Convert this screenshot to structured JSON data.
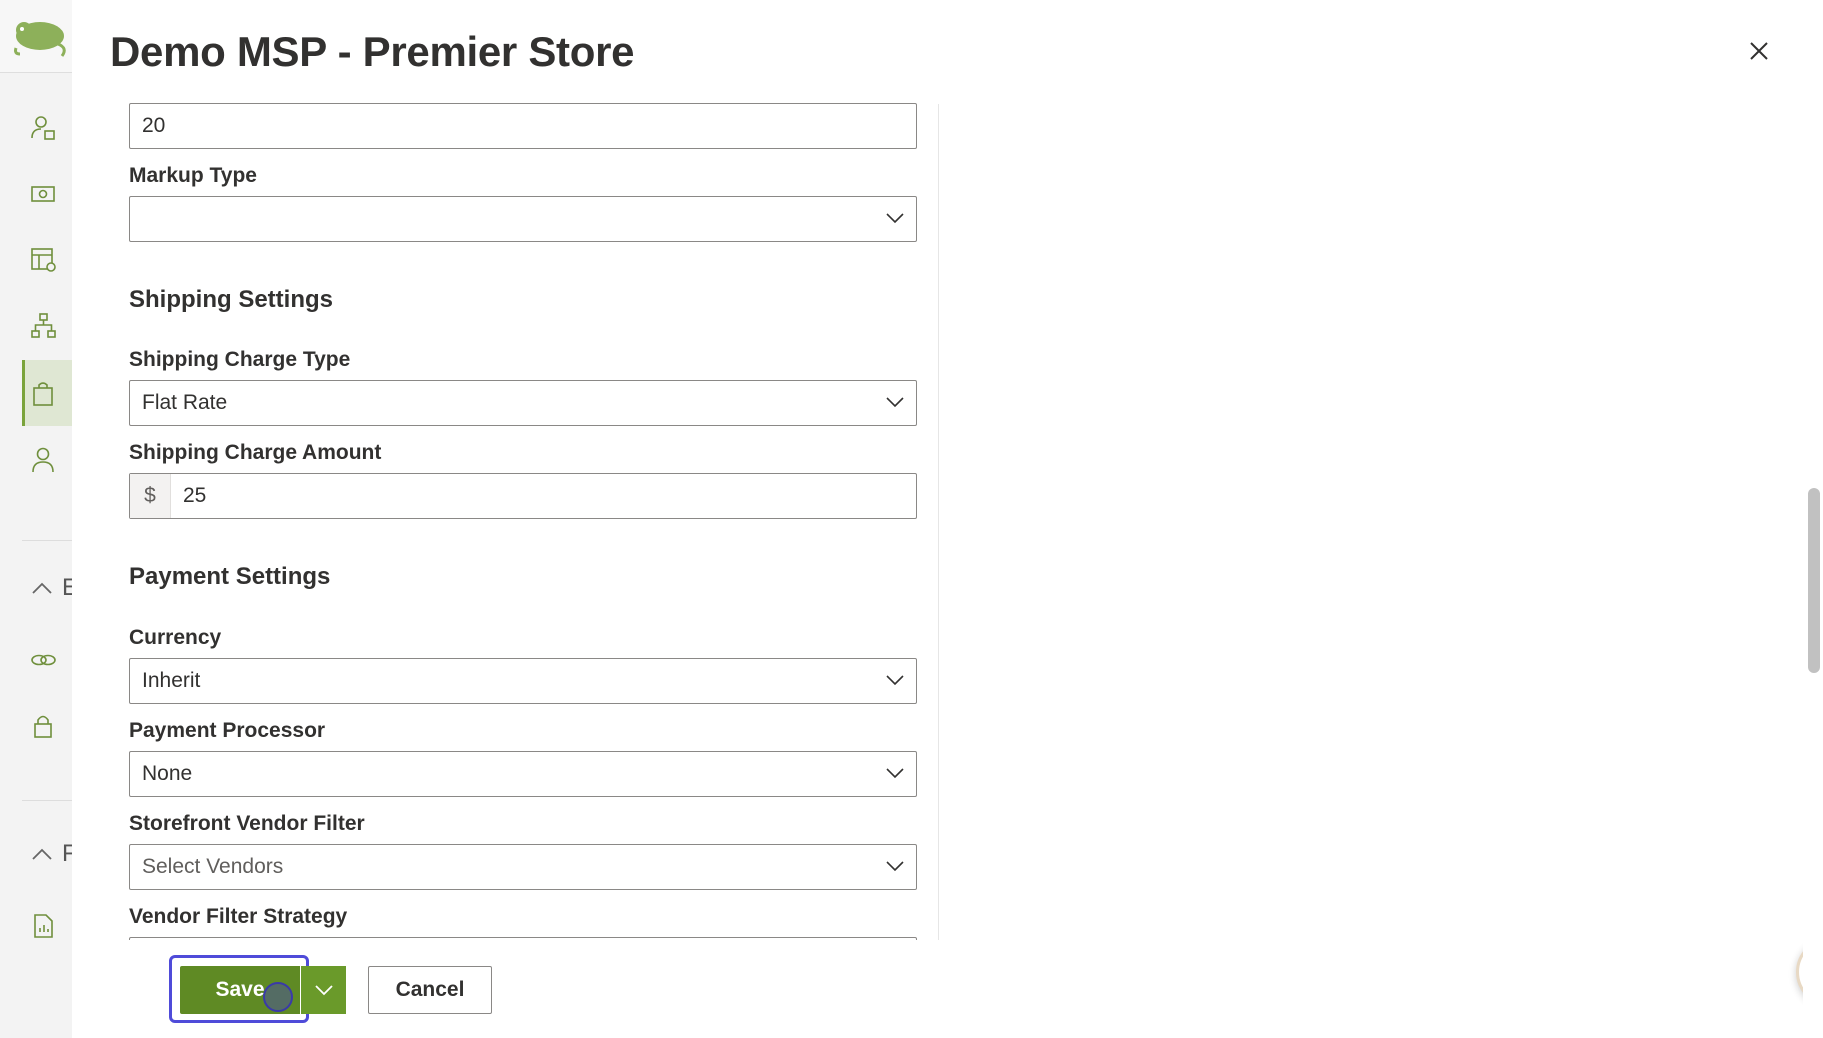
{
  "dialog": {
    "title": "Demo MSP - Premier Store"
  },
  "form": {
    "markup_value": "20",
    "markup_type": {
      "label": "Markup Type",
      "value": ""
    },
    "shipping_section": "Shipping Settings",
    "shipping_charge_type": {
      "label": "Shipping Charge Type",
      "value": "Flat Rate"
    },
    "shipping_charge_amount": {
      "label": "Shipping Charge Amount",
      "prefix": "$",
      "value": "25"
    },
    "payment_section": "Payment Settings",
    "currency": {
      "label": "Currency",
      "value": "Inherit"
    },
    "payment_processor": {
      "label": "Payment Processor",
      "value": "None"
    },
    "vendor_filter": {
      "label": "Storefront Vendor Filter",
      "placeholder": "Select Vendors"
    },
    "vendor_filter_strategy": {
      "label": "Vendor Filter Strategy"
    }
  },
  "footer": {
    "save_label": "Save",
    "cancel_label": "Cancel"
  },
  "sidebar": {
    "letters": [
      "E",
      "F"
    ]
  },
  "colors": {
    "primary": "#5f8a24",
    "focus_ring": "#4f4bd9",
    "brand_green": "#7aa33a"
  },
  "icons": {
    "close": "close-icon",
    "dropdown": "chevron-down-icon",
    "help": "help-fab-icon"
  }
}
